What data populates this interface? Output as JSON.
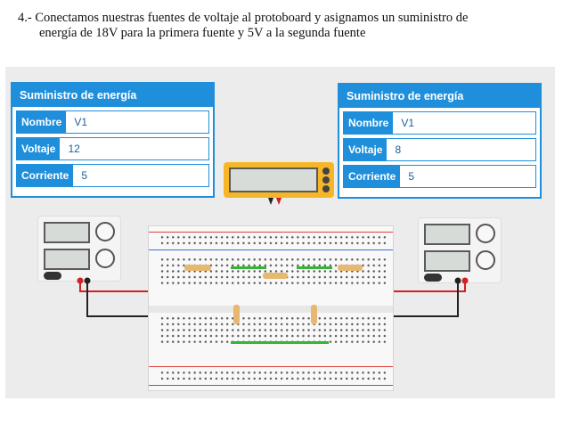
{
  "caption": {
    "line1": "4.- Conectamos nuestras fuentes de voltaje al protoboard y asignamos un suministro de",
    "line2": "energía de 18V para la primera fuente y 5V a la segunda fuente"
  },
  "left_supply_panel": {
    "title": "Suministro de energía",
    "fields": [
      {
        "label": "Nombre",
        "value": "V1"
      },
      {
        "label": "Voltaje",
        "value": "12"
      },
      {
        "label": "Corriente",
        "value": "5"
      }
    ]
  },
  "right_supply_panel": {
    "title": "Suministro de energía",
    "fields": [
      {
        "label": "Nombre",
        "value": "V1"
      },
      {
        "label": "Voltaje",
        "value": "8"
      },
      {
        "label": "Corriente",
        "value": "5"
      }
    ]
  },
  "colors": {
    "panel_blue": "#1f8fdc",
    "wire_red": "#d32020",
    "wire_black": "#222222",
    "multimeter": "#f7b628",
    "breadboard_green_strip": "#35b535"
  }
}
